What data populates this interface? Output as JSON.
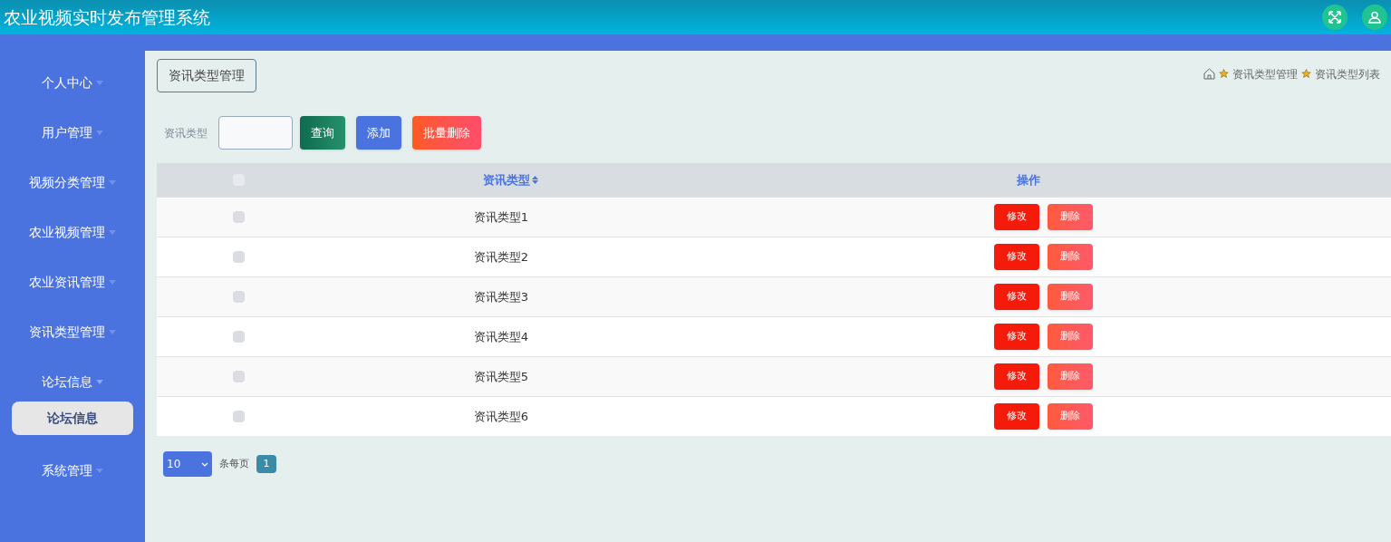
{
  "header": {
    "title": "农业视频实时发布管理系统"
  },
  "sidebar": {
    "items": [
      {
        "label": "个人中心",
        "expanded": false
      },
      {
        "label": "用户管理",
        "expanded": false
      },
      {
        "label": "视频分类管理",
        "expanded": false
      },
      {
        "label": "农业视频管理",
        "expanded": false
      },
      {
        "label": "农业资讯管理",
        "expanded": false
      },
      {
        "label": "资讯类型管理",
        "expanded": false
      },
      {
        "label": "论坛信息",
        "expanded": true,
        "children": [
          {
            "label": "论坛信息",
            "selected": true
          }
        ]
      },
      {
        "label": "系统管理",
        "expanded": false
      }
    ]
  },
  "page_title": "资讯类型管理",
  "breadcrumb": [
    "资讯类型管理",
    "资讯类型列表"
  ],
  "search": {
    "label": "资讯类型",
    "buttons": [
      {
        "label": "查询",
        "kind": "query"
      },
      {
        "label": "添加",
        "kind": "add"
      },
      {
        "label": "批量删除",
        "kind": "delete"
      }
    ]
  },
  "table": {
    "select_all": {
      "checked": false
    },
    "columns": [
      "资讯类型",
      "操作"
    ],
    "rows": [
      {
        "checked": false,
        "type": "资讯类型1",
        "actions": [
          "修改",
          "删除"
        ]
      },
      {
        "checked": false,
        "type": "资讯类型2",
        "actions": [
          "修改",
          "删除"
        ]
      },
      {
        "checked": false,
        "type": "资讯类型3",
        "actions": [
          "修改",
          "删除"
        ]
      },
      {
        "checked": false,
        "type": "资讯类型4",
        "actions": [
          "修改",
          "删除"
        ]
      },
      {
        "checked": false,
        "type": "资讯类型5",
        "actions": [
          "修改",
          "删除"
        ]
      },
      {
        "checked": false,
        "type": "资讯类型6",
        "actions": [
          "修改",
          "删除"
        ]
      }
    ]
  },
  "pagination": {
    "page_size": "10",
    "per_page_label": "条每页",
    "pages": [
      {
        "label": "1",
        "selected": true
      }
    ]
  }
}
